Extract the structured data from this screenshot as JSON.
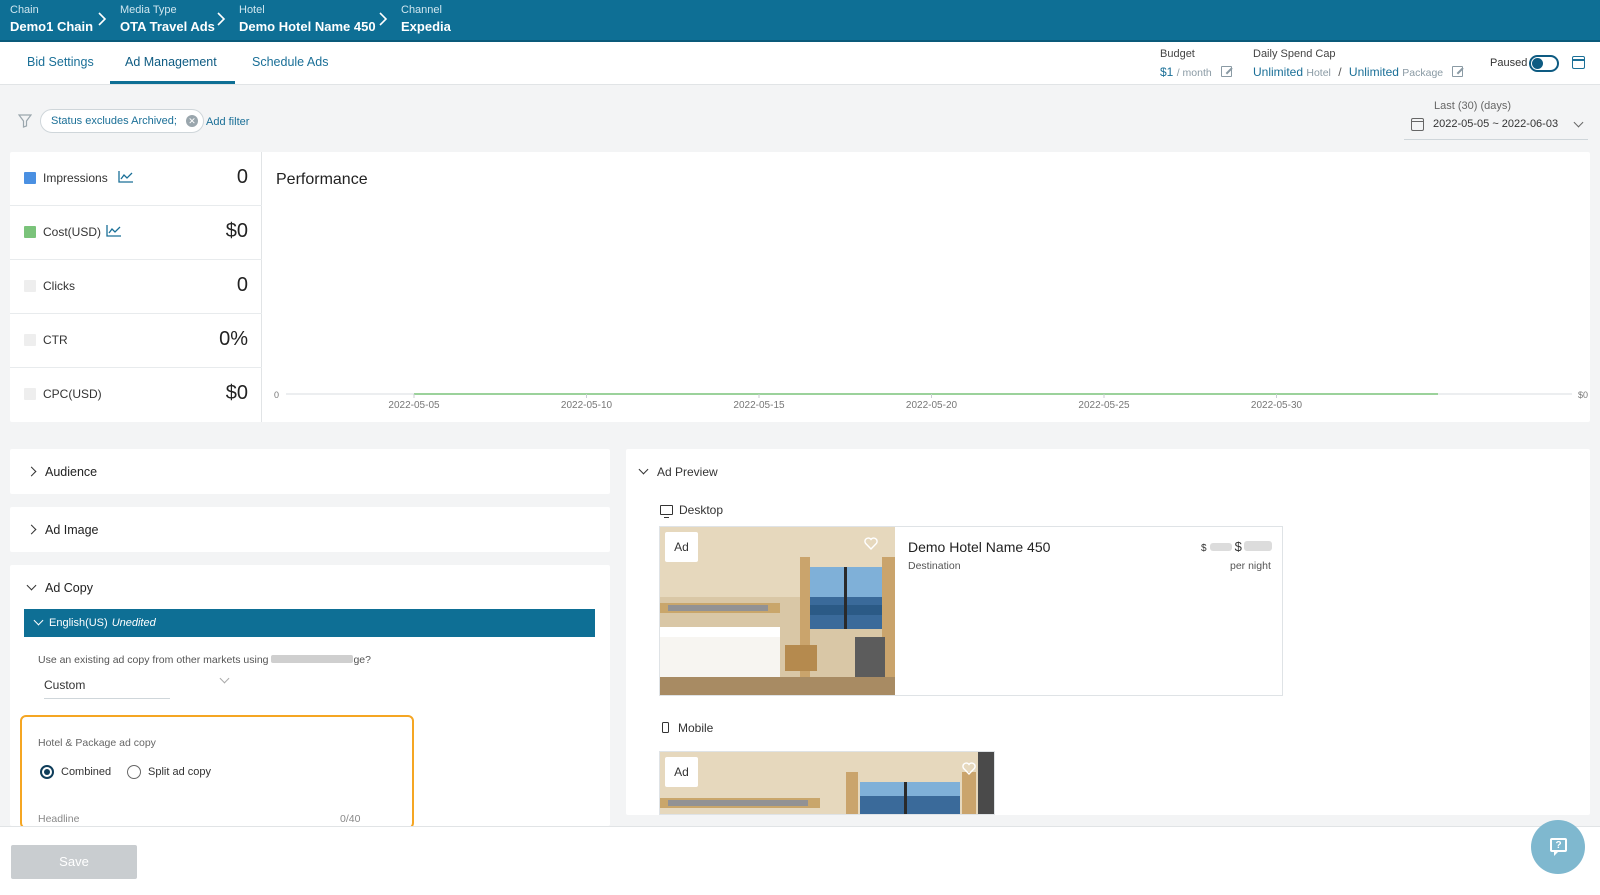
{
  "breadcrumb": [
    {
      "label": "Chain",
      "value": "Demo1 Chain"
    },
    {
      "label": "Media Type",
      "value": "OTA Travel Ads"
    },
    {
      "label": "Hotel",
      "value": "Demo Hotel Name 450"
    },
    {
      "label": "Channel",
      "value": "Expedia"
    }
  ],
  "tabs": [
    {
      "label": "Bid Settings"
    },
    {
      "label": "Ad Management"
    },
    {
      "label": "Schedule Ads"
    }
  ],
  "budget": {
    "label": "Budget",
    "value": "$1",
    "unit": "/ month"
  },
  "daily_cap": {
    "label": "Daily Spend Cap",
    "hotel_value": "Unlimited",
    "hotel_unit": "Hotel",
    "separator": "/",
    "package_value": "Unlimited",
    "package_unit": "Package"
  },
  "paused_label": "Paused",
  "filter": {
    "chip": "Status excludes Archived;",
    "add": "Add filter"
  },
  "date_range": {
    "label": "Last (30) (days)",
    "value": "2022-05-05 ~ 2022-06-03"
  },
  "metrics": [
    {
      "label": "Impressions",
      "value": "0",
      "color": "#4a90e2",
      "trend": true
    },
    {
      "label": "Cost(USD)",
      "value": "$0",
      "color": "#7ac37a",
      "trend": true
    },
    {
      "label": "Clicks",
      "value": "0",
      "color": "#eeeeee",
      "trend": false
    },
    {
      "label": "CTR",
      "value": "0%",
      "color": "#eeeeee",
      "trend": false
    },
    {
      "label": "CPC(USD)",
      "value": "$0",
      "color": "#eeeeee",
      "trend": false
    }
  ],
  "performance": {
    "title": "Performance",
    "y_left": "0",
    "y_right": "$0",
    "x_ticks": [
      "2022-05-05",
      "2022-05-10",
      "2022-05-15",
      "2022-05-20",
      "2022-05-25",
      "2022-05-30"
    ]
  },
  "panels": {
    "audience": "Audience",
    "ad_image": "Ad Image",
    "ad_copy": "Ad Copy"
  },
  "ad_copy": {
    "language": "English(US)",
    "status": "Unedited",
    "question_prefix": "Use an existing ad copy from other markets using ",
    "question_suffix": "ge?",
    "select_value": "Custom",
    "section_label": "Hotel & Package ad copy",
    "option_combined": "Combined",
    "option_split": "Split ad copy",
    "headline_label": "Headline",
    "headline_count": "0/40"
  },
  "ad_preview": {
    "title": "Ad Preview",
    "desktop": "Desktop",
    "mobile": "Mobile",
    "badge": "Ad",
    "hotel_name": "Demo Hotel Name 450",
    "destination": "Destination",
    "currency": "$",
    "per_night": "per night"
  },
  "save_label": "Save",
  "help_glyph": "?"
}
